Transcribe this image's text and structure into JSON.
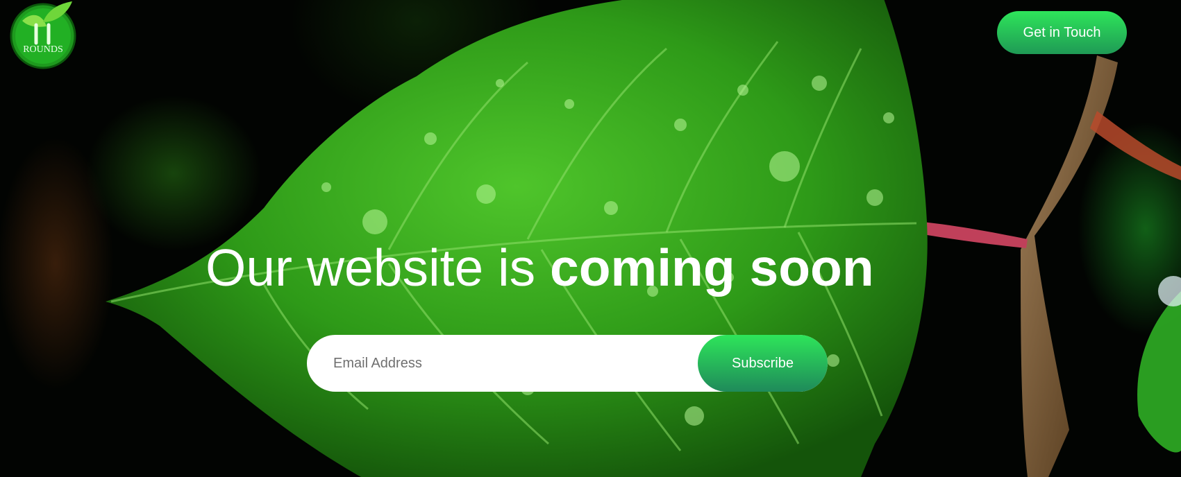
{
  "brand": {
    "logo_text": "ROUNDS",
    "logo_number": "11"
  },
  "header": {
    "cta_label": "Get in Touch"
  },
  "hero": {
    "headline_regular": "Our website is ",
    "headline_bold": "coming soon"
  },
  "subscribe": {
    "email_placeholder": "Email Address",
    "button_label": "Subscribe"
  },
  "colors": {
    "accent_top": "#2ee55a",
    "accent_bottom": "#1f9a55",
    "leaf_green": "#2f9e1c",
    "background": "#020402"
  },
  "icons": {
    "logo": "leaf-logo-icon"
  }
}
